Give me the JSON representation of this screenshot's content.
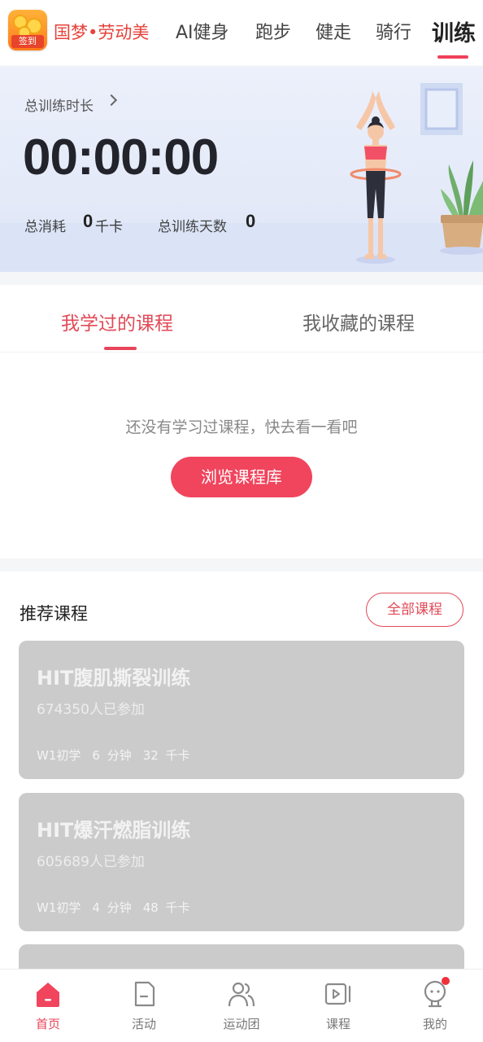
{
  "top_nav": {
    "logo_badge": "签到",
    "brand": "国梦•劳动美",
    "tabs": [
      {
        "label": "AI健身"
      },
      {
        "label": "跑步"
      },
      {
        "label": "健走"
      },
      {
        "label": "骑行"
      },
      {
        "label": "训练",
        "active": true
      }
    ]
  },
  "summary": {
    "duration_label": "总训练时长",
    "duration_value": "00:00:00",
    "calories_label": "总消耗",
    "calories_value": "0",
    "calories_unit": "千卡",
    "days_label": "总训练天数",
    "days_value": "0"
  },
  "course_tabs": {
    "learned": "我学过的课程",
    "favorites": "我收藏的课程",
    "active": "learned"
  },
  "empty_state": {
    "message": "还没有学习过课程，快去看一看吧",
    "button": "浏览课程库"
  },
  "recommended": {
    "title": "推荐课程",
    "all_button": "全部课程",
    "courses": [
      {
        "name": "HIT腹肌撕裂训练",
        "participants": "674350人已参加",
        "level": "W1初学",
        "duration": "6 分钟",
        "calories": "32 千卡"
      },
      {
        "name": "HIT爆汗燃脂训练",
        "participants": "605689人已参加",
        "level": "W1初学",
        "duration": "4 分钟",
        "calories": "48 千卡"
      }
    ]
  },
  "bottom_nav": {
    "items": [
      {
        "label": "首页",
        "icon": "home-icon",
        "active": true
      },
      {
        "label": "活动",
        "icon": "activity-icon"
      },
      {
        "label": "运动团",
        "icon": "group-icon"
      },
      {
        "label": "课程",
        "icon": "course-video-icon"
      },
      {
        "label": "我的",
        "icon": "profile-icon",
        "has_badge": true
      }
    ]
  },
  "colors": {
    "accent": "#e8445a",
    "brand_red": "#e5433b",
    "card_placeholder": "#cbcbcb"
  }
}
